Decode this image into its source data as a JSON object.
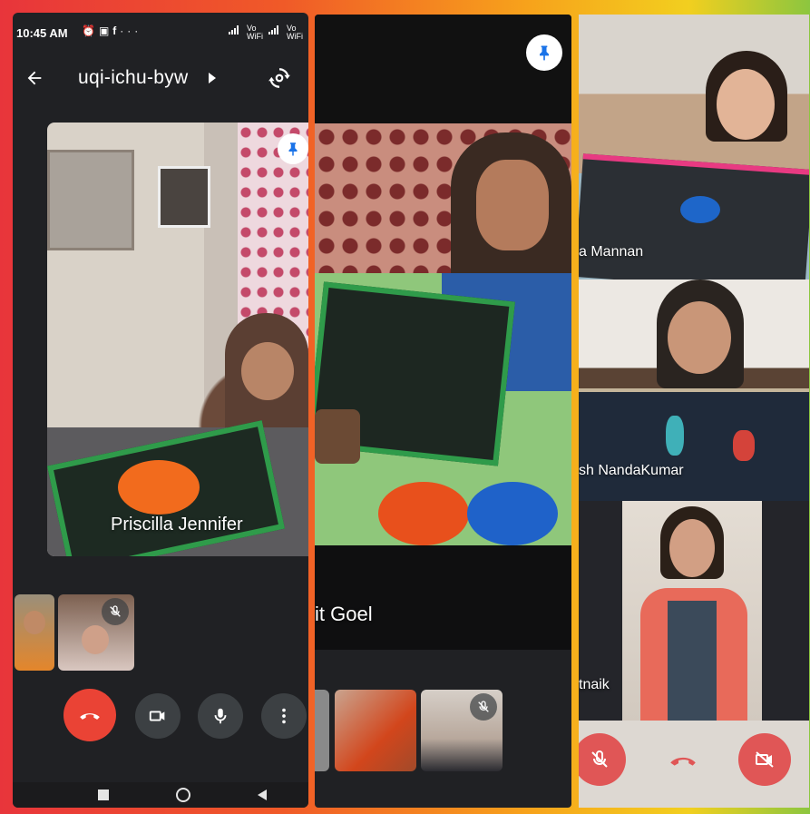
{
  "status_bar": {
    "time": "10:45 AM",
    "notification_icons": [
      "alarm-icon",
      "message-icon",
      "facebook-icon",
      "more-icon"
    ],
    "network_labels": [
      "Vo WiFi",
      "Vo WiFi"
    ]
  },
  "meeting": {
    "code": "uqi-ichu-byw"
  },
  "panel1": {
    "main_participant": "Priscilla Jennifer",
    "controls": [
      "end-call",
      "camera",
      "microphone",
      "more-options"
    ]
  },
  "panel2": {
    "main_participant": "it Goel"
  },
  "panel3": {
    "tiles": [
      {
        "label": "a Mannan"
      },
      {
        "label": "sh NandaKumar"
      },
      {
        "label": "tnaik"
      }
    ]
  },
  "colors": {
    "end_call": "#ea4335",
    "panel_bg": "#202124",
    "control_bg": "#3c4043"
  }
}
